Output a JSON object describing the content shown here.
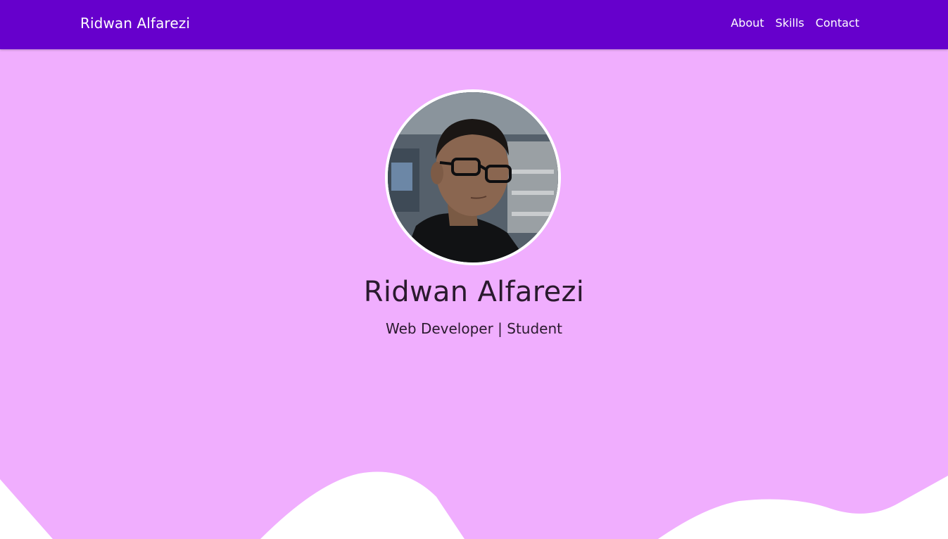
{
  "navbar": {
    "brand": "Ridwan Alfarezi",
    "links": [
      {
        "label": "About"
      },
      {
        "label": "Skills"
      },
      {
        "label": "Contact"
      }
    ],
    "background_color": "#6600cc"
  },
  "hero": {
    "name": "Ridwan Alfarezi",
    "subtitle": "Web Developer | Student",
    "background_color": "#f0aefe",
    "avatar_icon": "profile-photo"
  }
}
